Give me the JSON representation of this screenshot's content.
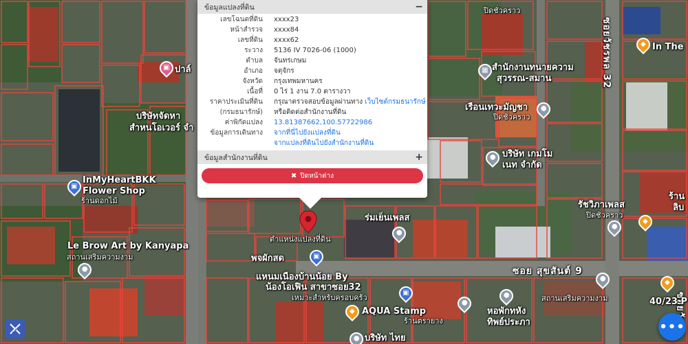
{
  "map": {
    "labels": {
      "pla": "ปาล์",
      "company_top_left_1": "บริษัทจัดหา",
      "company_top_left_2": "สำหนโอเวอร์ จำ",
      "heart_shop_1": "InMyHeartBKK",
      "heart_shop_2": "Flower Shop",
      "heart_shop_3": "ร้านดอกไม้",
      "le_brow_1": "Le Brow Art by Kanyapa",
      "le_brow_2": "สถานเสริมความงาม",
      "land_office_1": "สำนักงานทนายความ",
      "land_office_2": "สุวรรณ-สมาน",
      "in_the": "In The",
      "ruenthewa_1": "เรือนเทวะมัญชา",
      "ruenthewa_2": "ปิดชั่วคราว",
      "pidchua_top": "ปิดชั่วคราว",
      "company_right_1": "บริษัท เกมโม",
      "company_right_2": "เนท จำกัด",
      "rachapa_1": "รัชวิภาเพลส",
      "rachapa_2": "ปิดชั่วคราว",
      "rom_yen": "ร่มเย็นเพลส",
      "pin_label": "ตำแหน่งแปลงที่ดิน",
      "soi_sukhasan": "ซอย สุขสันต์ 9",
      "soi_vertical": "ซอยวัชรพล 32",
      "soi_vertical_2": "ซอยวัชร",
      "phak_sod": "พจผักสด",
      "restaurant_1": "แหนมเนืองบ้านน้อย By",
      "restaurant_2": "น้องโอเฟิน สาขาซอย32",
      "restaurant_3": "เหมาะสำหรับครอบครัว",
      "aqua_1": "AQUA Stamp",
      "aqua_2": "ร้านตรายาง",
      "spa": "สถานเสริมความงาม",
      "horpak_1": "หอพักทหัง",
      "horpak_2": "ทิพย์ประภา",
      "company_bottom": "บริษัท ไทย",
      "address_4023": "40/23 P",
      "ran_right": "ร้าน",
      "lib": "ลิบ"
    }
  },
  "popup": {
    "section1_title": "ข้อมูลแปลงที่ดิน",
    "section1_toggle": "−",
    "rows": [
      {
        "label": "เลขโฉนดที่ดิน",
        "value": "xxxx23"
      },
      {
        "label": "หน้าสำรวจ",
        "value": "xxxx84"
      },
      {
        "label": "เลขที่ดิน",
        "value": "xxxx62"
      },
      {
        "label": "ระวาง",
        "value": "5136 IV 7026-06 (1000)"
      },
      {
        "label": "ตำบล",
        "value": "จันทรเกษม"
      },
      {
        "label": "อำเภอ",
        "value": "จตุจักร"
      },
      {
        "label": "จังหวัด",
        "value": "กรุงเทพมหานคร"
      },
      {
        "label": "เนื้อที่",
        "value": "0 ไร่ 1 งาน 7.0 ตารางวา"
      }
    ],
    "price_label_1": "ราคาประเมินที่ดิน",
    "price_label_2": "(กรมธนารักษ์)",
    "price_value_1": "กรุณาตรวจสอบข้อมูลผ่านทาง",
    "price_link": "เว็บไซต์กรมธนารักษ์",
    "price_value_2": "หรือติดต่อสำนักงานที่ดิน",
    "coord_label": "ค่าพิกัดแปลง",
    "coord_value": "13.81387662,100.57722986",
    "travel_label": "ข้อมูลการเดินทาง",
    "travel_link_1": "จากที่นี่ไปยังแปลงที่ดิน",
    "travel_link_2": "จากแปลงที่ดินไปยังสำนักงานที่ดิน",
    "section2_title": "ข้อมูลสำนักงานที่ดิน",
    "section2_toggle": "+",
    "close_icon": "✖",
    "close_label": "ปิดหน้าต่าง"
  },
  "buttons": {
    "fab_glyph": "•••"
  },
  "colors": {
    "parcel_line": "#e8453c",
    "pin": "#d9232e",
    "close_button": "#dc3545",
    "link": "#1a73e8"
  }
}
